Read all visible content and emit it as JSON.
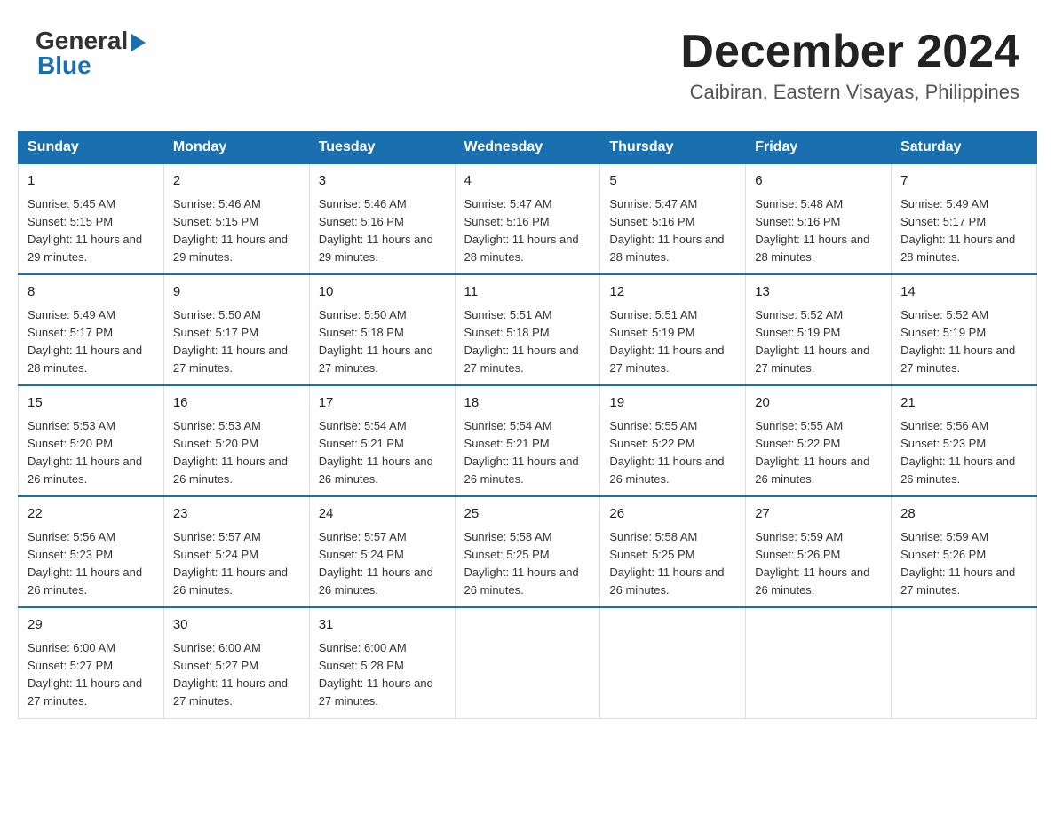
{
  "header": {
    "logo_general": "General",
    "logo_blue": "Blue",
    "month_title": "December 2024",
    "location": "Caibiran, Eastern Visayas, Philippines"
  },
  "weekdays": [
    "Sunday",
    "Monday",
    "Tuesday",
    "Wednesday",
    "Thursday",
    "Friday",
    "Saturday"
  ],
  "weeks": [
    [
      {
        "day": "1",
        "sunrise": "5:45 AM",
        "sunset": "5:15 PM",
        "daylight": "11 hours and 29 minutes."
      },
      {
        "day": "2",
        "sunrise": "5:46 AM",
        "sunset": "5:15 PM",
        "daylight": "11 hours and 29 minutes."
      },
      {
        "day": "3",
        "sunrise": "5:46 AM",
        "sunset": "5:16 PM",
        "daylight": "11 hours and 29 minutes."
      },
      {
        "day": "4",
        "sunrise": "5:47 AM",
        "sunset": "5:16 PM",
        "daylight": "11 hours and 28 minutes."
      },
      {
        "day": "5",
        "sunrise": "5:47 AM",
        "sunset": "5:16 PM",
        "daylight": "11 hours and 28 minutes."
      },
      {
        "day": "6",
        "sunrise": "5:48 AM",
        "sunset": "5:16 PM",
        "daylight": "11 hours and 28 minutes."
      },
      {
        "day": "7",
        "sunrise": "5:49 AM",
        "sunset": "5:17 PM",
        "daylight": "11 hours and 28 minutes."
      }
    ],
    [
      {
        "day": "8",
        "sunrise": "5:49 AM",
        "sunset": "5:17 PM",
        "daylight": "11 hours and 28 minutes."
      },
      {
        "day": "9",
        "sunrise": "5:50 AM",
        "sunset": "5:17 PM",
        "daylight": "11 hours and 27 minutes."
      },
      {
        "day": "10",
        "sunrise": "5:50 AM",
        "sunset": "5:18 PM",
        "daylight": "11 hours and 27 minutes."
      },
      {
        "day": "11",
        "sunrise": "5:51 AM",
        "sunset": "5:18 PM",
        "daylight": "11 hours and 27 minutes."
      },
      {
        "day": "12",
        "sunrise": "5:51 AM",
        "sunset": "5:19 PM",
        "daylight": "11 hours and 27 minutes."
      },
      {
        "day": "13",
        "sunrise": "5:52 AM",
        "sunset": "5:19 PM",
        "daylight": "11 hours and 27 minutes."
      },
      {
        "day": "14",
        "sunrise": "5:52 AM",
        "sunset": "5:19 PM",
        "daylight": "11 hours and 27 minutes."
      }
    ],
    [
      {
        "day": "15",
        "sunrise": "5:53 AM",
        "sunset": "5:20 PM",
        "daylight": "11 hours and 26 minutes."
      },
      {
        "day": "16",
        "sunrise": "5:53 AM",
        "sunset": "5:20 PM",
        "daylight": "11 hours and 26 minutes."
      },
      {
        "day": "17",
        "sunrise": "5:54 AM",
        "sunset": "5:21 PM",
        "daylight": "11 hours and 26 minutes."
      },
      {
        "day": "18",
        "sunrise": "5:54 AM",
        "sunset": "5:21 PM",
        "daylight": "11 hours and 26 minutes."
      },
      {
        "day": "19",
        "sunrise": "5:55 AM",
        "sunset": "5:22 PM",
        "daylight": "11 hours and 26 minutes."
      },
      {
        "day": "20",
        "sunrise": "5:55 AM",
        "sunset": "5:22 PM",
        "daylight": "11 hours and 26 minutes."
      },
      {
        "day": "21",
        "sunrise": "5:56 AM",
        "sunset": "5:23 PM",
        "daylight": "11 hours and 26 minutes."
      }
    ],
    [
      {
        "day": "22",
        "sunrise": "5:56 AM",
        "sunset": "5:23 PM",
        "daylight": "11 hours and 26 minutes."
      },
      {
        "day": "23",
        "sunrise": "5:57 AM",
        "sunset": "5:24 PM",
        "daylight": "11 hours and 26 minutes."
      },
      {
        "day": "24",
        "sunrise": "5:57 AM",
        "sunset": "5:24 PM",
        "daylight": "11 hours and 26 minutes."
      },
      {
        "day": "25",
        "sunrise": "5:58 AM",
        "sunset": "5:25 PM",
        "daylight": "11 hours and 26 minutes."
      },
      {
        "day": "26",
        "sunrise": "5:58 AM",
        "sunset": "5:25 PM",
        "daylight": "11 hours and 26 minutes."
      },
      {
        "day": "27",
        "sunrise": "5:59 AM",
        "sunset": "5:26 PM",
        "daylight": "11 hours and 26 minutes."
      },
      {
        "day": "28",
        "sunrise": "5:59 AM",
        "sunset": "5:26 PM",
        "daylight": "11 hours and 27 minutes."
      }
    ],
    [
      {
        "day": "29",
        "sunrise": "6:00 AM",
        "sunset": "5:27 PM",
        "daylight": "11 hours and 27 minutes."
      },
      {
        "day": "30",
        "sunrise": "6:00 AM",
        "sunset": "5:27 PM",
        "daylight": "11 hours and 27 minutes."
      },
      {
        "day": "31",
        "sunrise": "6:00 AM",
        "sunset": "5:28 PM",
        "daylight": "11 hours and 27 minutes."
      },
      null,
      null,
      null,
      null
    ]
  ]
}
